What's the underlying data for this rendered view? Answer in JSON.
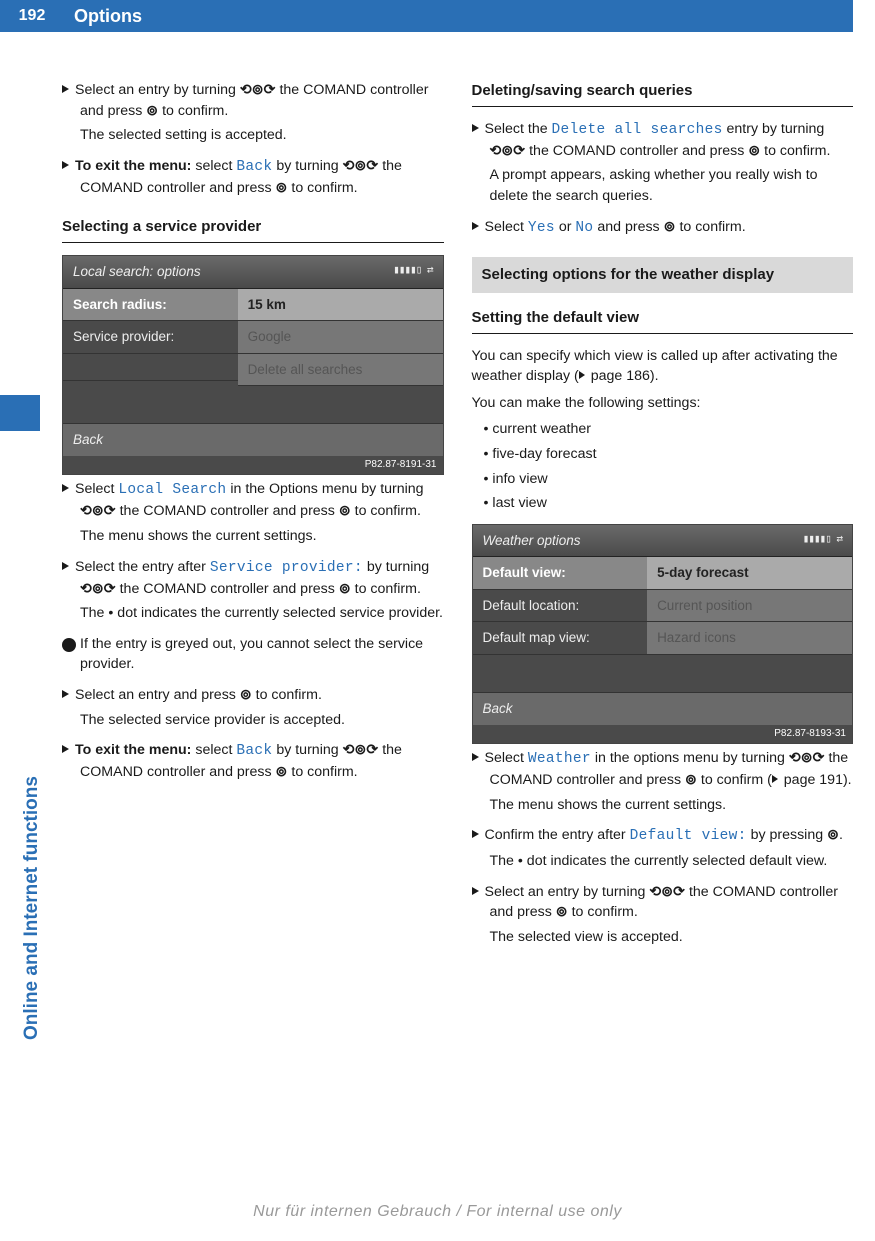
{
  "page": {
    "number": "192",
    "title": "Options"
  },
  "sideLabel": "Online and Internet functions",
  "icons": {
    "rotary": "⟲⊚⟳",
    "rotary2": "⟲⊚⟳",
    "press": "⊚",
    "pageref": "▷"
  },
  "col1": {
    "step1_a": "Select an entry by turning ",
    "step1_b": " the COMAND controller and press ",
    "step1_c": " to confirm.",
    "step1_res": "The selected setting is accepted.",
    "step2_bold": "To exit the menu:",
    "step2_a": " select ",
    "step2_ui": "Back",
    "step2_b": " by turning ",
    "step2_c": " the COMAND controller and press ",
    "step2_d": " to confirm.",
    "h3a": "Selecting a service provider",
    "shot1": {
      "title": "Local search: options",
      "rows": {
        "labels": [
          "Search radius:",
          "Service provider:",
          ""
        ],
        "values": [
          "15 km",
          "Google",
          "Delete all searches"
        ]
      },
      "back": "Back",
      "id": "P82.87-8191-31"
    },
    "step3_a": "Select ",
    "step3_ui": "Local Search",
    "step3_b": " in the Options menu by turning ",
    "step3_c": " the COMAND controller and press ",
    "step3_d": " to confirm.",
    "step3_res": "The menu shows the current settings.",
    "step4_a": "Select the entry after ",
    "step4_ui": "Service provider:",
    "step4_b": " by turning ",
    "step4_c": " the COMAND controller and press ",
    "step4_d": " to confirm.",
    "step4_res": "The • dot indicates the currently selected service provider.",
    "info": "If the entry is greyed out, you cannot select the service provider.",
    "step5_a": "Select an entry and press ",
    "step5_b": " to confirm.",
    "step5_res": "The selected service provider is accepted.",
    "step6_bold": "To exit the menu:",
    "step6_a": " select ",
    "step6_ui": "Back",
    "step6_b": " by turning ",
    "step6_c": " the COMAND controller and press ",
    "step6_d": " to confirm."
  },
  "col2": {
    "h3a": "Deleting/saving search queries",
    "d1_a": "Select the ",
    "d1_ui": "Delete all searches",
    "d1_b": " entry by turning ",
    "d1_c": " the COMAND controller and press ",
    "d1_d": " to confirm.",
    "d1_res": "A prompt appears, asking whether you really wish to delete the search queries.",
    "d2_a": "Select ",
    "d2_yes": "Yes",
    "d2_mid": " or ",
    "d2_no": "No",
    "d2_b": " and press ",
    "d2_c": " to confirm.",
    "h2": "Selecting options for the weather display",
    "h3b": "Setting the default view",
    "p1_a": "You can specify which view is called up after activating the weather display (",
    "p1_pref": " page 186).",
    "p2": "You can make the following settings:",
    "bullets": [
      "current weather",
      "five-day forecast",
      "info view",
      "last view"
    ],
    "shot2": {
      "title": "Weather options",
      "rows": {
        "labels": [
          "Default view:",
          "Default location:",
          "Default map view:"
        ],
        "values": [
          "5-day forecast",
          "Current position",
          "Hazard icons"
        ]
      },
      "back": "Back",
      "id": "P82.87-8193-31"
    },
    "w1_a": "Select ",
    "w1_ui": "Weather",
    "w1_b": " in the options menu by turning ",
    "w1_c": " the COMAND controller and press ",
    "w1_d": " to confirm (",
    "w1_pref": " page 191).",
    "w1_res": "The menu shows the current settings.",
    "w2_a": "Confirm the entry after ",
    "w2_ui": "Default view:",
    "w2_b": " by pressing ",
    "w2_c": ".",
    "w2_res": "The • dot indicates the currently selected default view.",
    "w3_a": "Select an entry by turning ",
    "w3_b": " the COMAND controller and press ",
    "w3_c": " to confirm.",
    "w3_res": "The selected view is accepted."
  },
  "watermark": "Nur für internen Gebrauch / For internal use only"
}
